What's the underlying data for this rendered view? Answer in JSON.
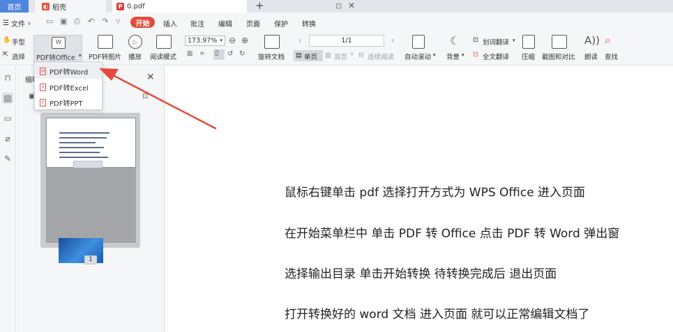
{
  "tabs": {
    "home": "首页",
    "docer": "稻壳",
    "pdf_file": "0.pdf"
  },
  "menu": {
    "file": "文件",
    "start": "开始",
    "items": [
      "插入",
      "批注",
      "编辑",
      "页面",
      "保护",
      "转换"
    ]
  },
  "ribbon": {
    "hand": "手型",
    "select": "选择",
    "pdf_to_office": "PDF转Office",
    "pdf_to_image": "PDF转图片",
    "play": "播放",
    "read_mode": "阅读模式",
    "zoom": "173.97%",
    "rotate": "旋转文档",
    "page": "1/1",
    "single_page": "单页",
    "double_page": "双页",
    "continuous": "连续阅读",
    "auto_scroll": "自动滚动",
    "background": "背景",
    "word_translate": "划词翻译",
    "full_translate": "全文翻译",
    "compress": "压缩",
    "screenshot_compare": "截图和对比",
    "read_aloud": "朗读",
    "find": "查找"
  },
  "thumbnail_panel": {
    "title": "缩略",
    "page_badge": "1"
  },
  "dropdown": {
    "items": [
      "PDF转Word",
      "PDF转Excel",
      "PDF转PPT"
    ]
  },
  "document": {
    "lines": [
      "鼠标右键单击 pdf   选择打开方式为 WPS Office   进入页面",
      "在开始菜单栏中   单击 PDF 转 Office   点击 PDF 转 Word   弹出窗",
      "选择输出目录   单击开始转换   待转换完成后   退出页面",
      "打开转换好的 word 文档   进入页面   就可以正常编辑文档了"
    ]
  },
  "colors": {
    "home_tab": "#4f86e0",
    "start_button": "#e14d3b",
    "arrow": "#e8483a"
  }
}
